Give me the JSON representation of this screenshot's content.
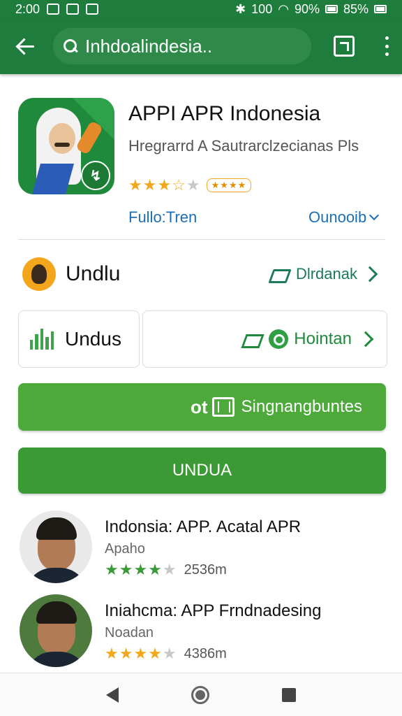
{
  "status_bar": {
    "time": "2:00",
    "signal_text": "100",
    "battery_pct": "90%",
    "battery_pct_2": "85%"
  },
  "search": {
    "query": "Inhdoalindesia.."
  },
  "app": {
    "title": "APPI APR Indonesia",
    "developer": "Hregrarrd A Sautrarclzecianas Pls",
    "rating_stars": 3.5,
    "rating_badge": "★★★★",
    "link_left": "Fullo:Tren",
    "link_right": "Ounooib"
  },
  "row1": {
    "label": "Undlu",
    "action": "Dlrdanak"
  },
  "row2": {
    "left_label": "Undus",
    "right_label": "Hointan"
  },
  "buttons": {
    "primary_prefix": "ot",
    "primary_label": "Singnangbuntes",
    "secondary_label": "UNDUA"
  },
  "list": [
    {
      "title": "Indonsia: APP. Acatal APR",
      "subtitle": "Apaho",
      "stars": 4,
      "count": "2536m"
    },
    {
      "title": "Iniahcma: APP Frndnadesing",
      "subtitle": "Noadan",
      "stars": 4,
      "count": "4386m"
    }
  ],
  "colors": {
    "primary_green": "#1e7d3c",
    "button_green": "#4ca93a",
    "link_blue": "#1a6fb5",
    "star": "#f2a81d"
  },
  "icons": [
    "back-icon",
    "search-icon",
    "share-icon",
    "more-vert-icon",
    "bars-icon",
    "arrow-icon",
    "chevron-right-icon"
  ]
}
